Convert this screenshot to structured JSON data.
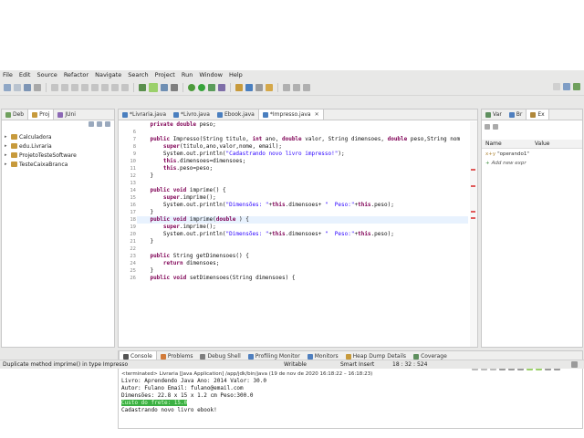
{
  "menu": [
    "File",
    "Edit",
    "Source",
    "Refactor",
    "Navigate",
    "Search",
    "Project",
    "Run",
    "Window",
    "Help"
  ],
  "left_tabs": [
    "Deb",
    "Proj",
    "JUni"
  ],
  "projects": [
    "Calculadora",
    "edu.Livraria",
    "ProjetoTesteSoftware",
    "TesteCaixaBranca"
  ],
  "editor_tabs": [
    "*Livraria.java",
    "*Livro.java",
    "Ebook.java",
    "*Impresso.java"
  ],
  "code_lines": [
    {
      "n": "",
      "t": "    private double peso;"
    },
    {
      "n": "6",
      "t": ""
    },
    {
      "n": "7",
      "t": "    public Impresso(String titulo, int ano, double valor, String dimensoes, double peso,String nom"
    },
    {
      "n": "8",
      "t": "        super(titulo,ano,valor,nome, email);"
    },
    {
      "n": "9",
      "t": "        System.out.println(\"Cadastrando novo livro impresso!\");"
    },
    {
      "n": "10",
      "t": "        this.dimensoes=dimensoes;"
    },
    {
      "n": "11",
      "t": "        this.peso=peso;"
    },
    {
      "n": "12",
      "t": "    }"
    },
    {
      "n": "13",
      "t": ""
    },
    {
      "n": "14",
      "t": "    public void imprime() {"
    },
    {
      "n": "15",
      "t": "        super.imprime();"
    },
    {
      "n": "16",
      "t": "        System.out.println(\"Dimensões: \"+this.dimensoes+ \"  Peso:\"+this.peso);"
    },
    {
      "n": "17",
      "t": "    }"
    },
    {
      "n": "18",
      "t": "    public void imprime(double ) {"
    },
    {
      "n": "19",
      "t": "        super.imprime();"
    },
    {
      "n": "20",
      "t": "        System.out.println(\"Dimensões: \"+this.dimensoes+ \"  Peso:\"+this.peso);"
    },
    {
      "n": "21",
      "t": "    }"
    },
    {
      "n": "22",
      "t": ""
    },
    {
      "n": "23",
      "t": "    public String getDimensoes() {"
    },
    {
      "n": "24",
      "t": "        return dimensoes;"
    },
    {
      "n": "25",
      "t": "    }"
    },
    {
      "n": "26",
      "t": "    public void setDimensoes(String dimensoes) {"
    }
  ],
  "right_tabs": [
    "Var",
    "Br",
    "Ex"
  ],
  "right_headers": {
    "name": "Name",
    "value": "Value"
  },
  "right_rows": [
    "\"operando1\"",
    "Add new expr"
  ],
  "bottom_tabs": [
    "Console",
    "Problems",
    "Debug Shell",
    "Profiling Monitor",
    "Monitors",
    "Heap Dump Details",
    "Coverage"
  ],
  "console": {
    "terminated": "<terminated> Livraria [Java Application] /app/jdk/bin/java (19 de nov de 2020 16:18:22 – 16:18:23)",
    "lines": [
      "Livro: Aprendendo Java Ano: 2014 Valor: 30.0",
      "Autor: Fulano Email: fulano@email.com",
      "Dimensões: 22.8 x 15 x 1.2 cm  Peso:300.0"
    ],
    "highlight": "Custo do frete: 15.0",
    "last": "Cadastrando novo livro ebook!"
  },
  "status": {
    "message": "Duplicate method imprime() in type Impresso",
    "writable": "Writable",
    "insert": "Smart Insert",
    "position": "18 : 32 : 524"
  }
}
